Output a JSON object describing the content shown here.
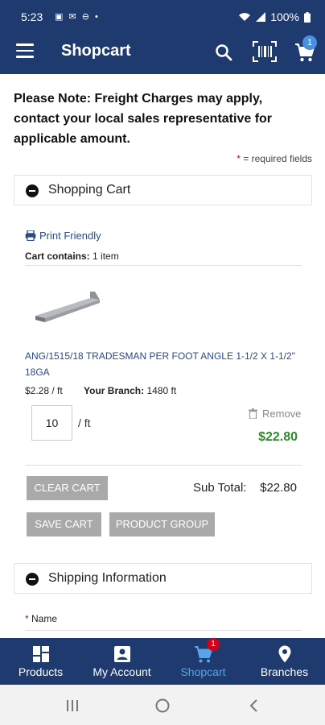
{
  "status_bar": {
    "time": "5:23",
    "battery": "100%"
  },
  "app_bar": {
    "title": "Shopcart",
    "cart_badge": "1"
  },
  "notice": {
    "freight": "Please Note: Freight Charges may apply, contact your local sales representative for applicable amount.",
    "required_star": "*",
    "required_text": "= required fields"
  },
  "shopping_cart": {
    "header": "Shopping Cart",
    "print_label": "Print Friendly",
    "contains_label": "Cart contains:",
    "contains_value": "1 item",
    "item": {
      "name": "ANG/1515/18 TRADESMAN PER FOOT ANGLE 1-1/2 X 1-1/2\" 18GA",
      "price": "$2.28 / ft",
      "branch_label": "Your Branch:",
      "branch_value": "1480 ft",
      "quantity": "10",
      "unit": "/ ft",
      "remove_label": "Remove",
      "line_total": "$22.80"
    },
    "clear_cart_label": "CLEAR CART",
    "subtotal_label": "Sub Total:",
    "subtotal_value": "$22.80",
    "save_cart_label": "SAVE CART",
    "product_group_label": "PRODUCT GROUP"
  },
  "shipping": {
    "header": "Shipping Information",
    "name_star": "*",
    "name_label": "Name"
  },
  "bottom_nav": {
    "items": [
      {
        "label": "Products",
        "icon": "grid-icon"
      },
      {
        "label": "My Account",
        "icon": "account-icon"
      },
      {
        "label": "Shopcart",
        "icon": "cart-icon"
      },
      {
        "label": "Branches",
        "icon": "location-pin-icon"
      }
    ],
    "badge": "1"
  },
  "colors": {
    "primary": "#1f3a6e",
    "accent": "#5aa3e6",
    "price_green": "#2e8b2e",
    "button_gray": "#a9a9a9"
  }
}
